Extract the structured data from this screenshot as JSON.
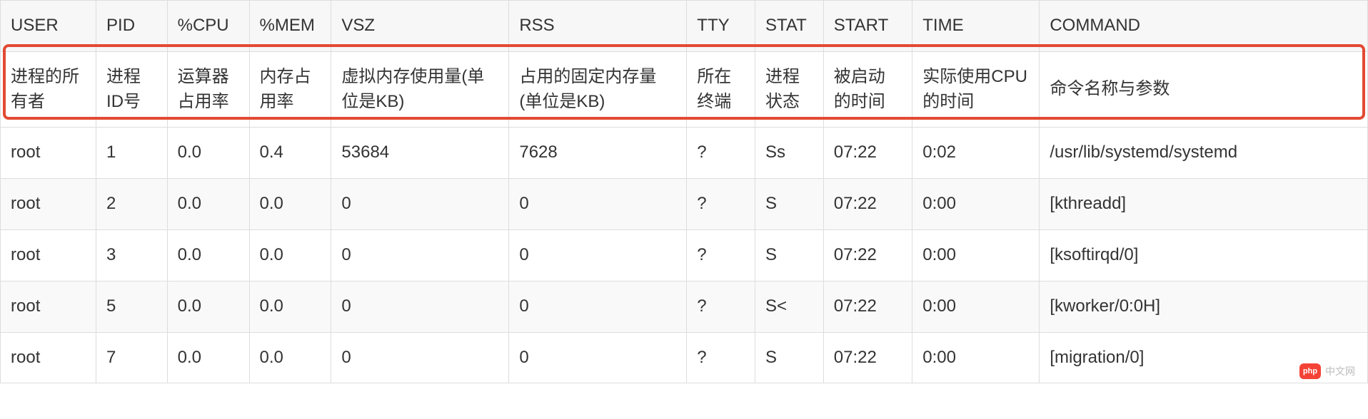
{
  "columns": [
    {
      "key": "user",
      "header": "USER",
      "desc": "进程的所有者"
    },
    {
      "key": "pid",
      "header": "PID",
      "desc": "进程ID号"
    },
    {
      "key": "cpu",
      "header": "%CPU",
      "desc": "运算器占用率"
    },
    {
      "key": "mem",
      "header": "%MEM",
      "desc": "内存占用率"
    },
    {
      "key": "vsz",
      "header": "VSZ",
      "desc": "虚拟内存使用量(单位是KB)"
    },
    {
      "key": "rss",
      "header": "RSS",
      "desc": "占用的固定内存量(单位是KB)"
    },
    {
      "key": "tty",
      "header": "TTY",
      "desc": "所在终端"
    },
    {
      "key": "stat",
      "header": "STAT",
      "desc": "进程状态"
    },
    {
      "key": "start",
      "header": "START",
      "desc": "被启动的时间"
    },
    {
      "key": "time",
      "header": "TIME",
      "desc": "实际使用CPU的时间"
    },
    {
      "key": "command",
      "header": "COMMAND",
      "desc": "命令名称与参数"
    }
  ],
  "rows": [
    {
      "user": "root",
      "pid": "1",
      "cpu": "0.0",
      "mem": "0.4",
      "vsz": "53684",
      "rss": "7628",
      "tty": "?",
      "stat": "Ss",
      "start": "07:22",
      "time": "0:02",
      "command": "/usr/lib/systemd/systemd"
    },
    {
      "user": "root",
      "pid": "2",
      "cpu": "0.0",
      "mem": "0.0",
      "vsz": "0",
      "rss": "0",
      "tty": "?",
      "stat": "S",
      "start": "07:22",
      "time": "0:00",
      "command": "[kthreadd]"
    },
    {
      "user": "root",
      "pid": "3",
      "cpu": "0.0",
      "mem": "0.0",
      "vsz": "0",
      "rss": "0",
      "tty": "?",
      "stat": "S",
      "start": "07:22",
      "time": "0:00",
      "command": "[ksoftirqd/0]"
    },
    {
      "user": "root",
      "pid": "5",
      "cpu": "0.0",
      "mem": "0.0",
      "vsz": "0",
      "rss": "0",
      "tty": "?",
      "stat": "S<",
      "start": "07:22",
      "time": "0:00",
      "command": "[kworker/0:0H]"
    },
    {
      "user": "root",
      "pid": "7",
      "cpu": "0.0",
      "mem": "0.0",
      "vsz": "0",
      "rss": "0",
      "tty": "?",
      "stat": "S",
      "start": "07:22",
      "time": "0:00",
      "command": "[migration/0]"
    }
  ],
  "watermark": {
    "logo": "php",
    "text": "中文网"
  }
}
